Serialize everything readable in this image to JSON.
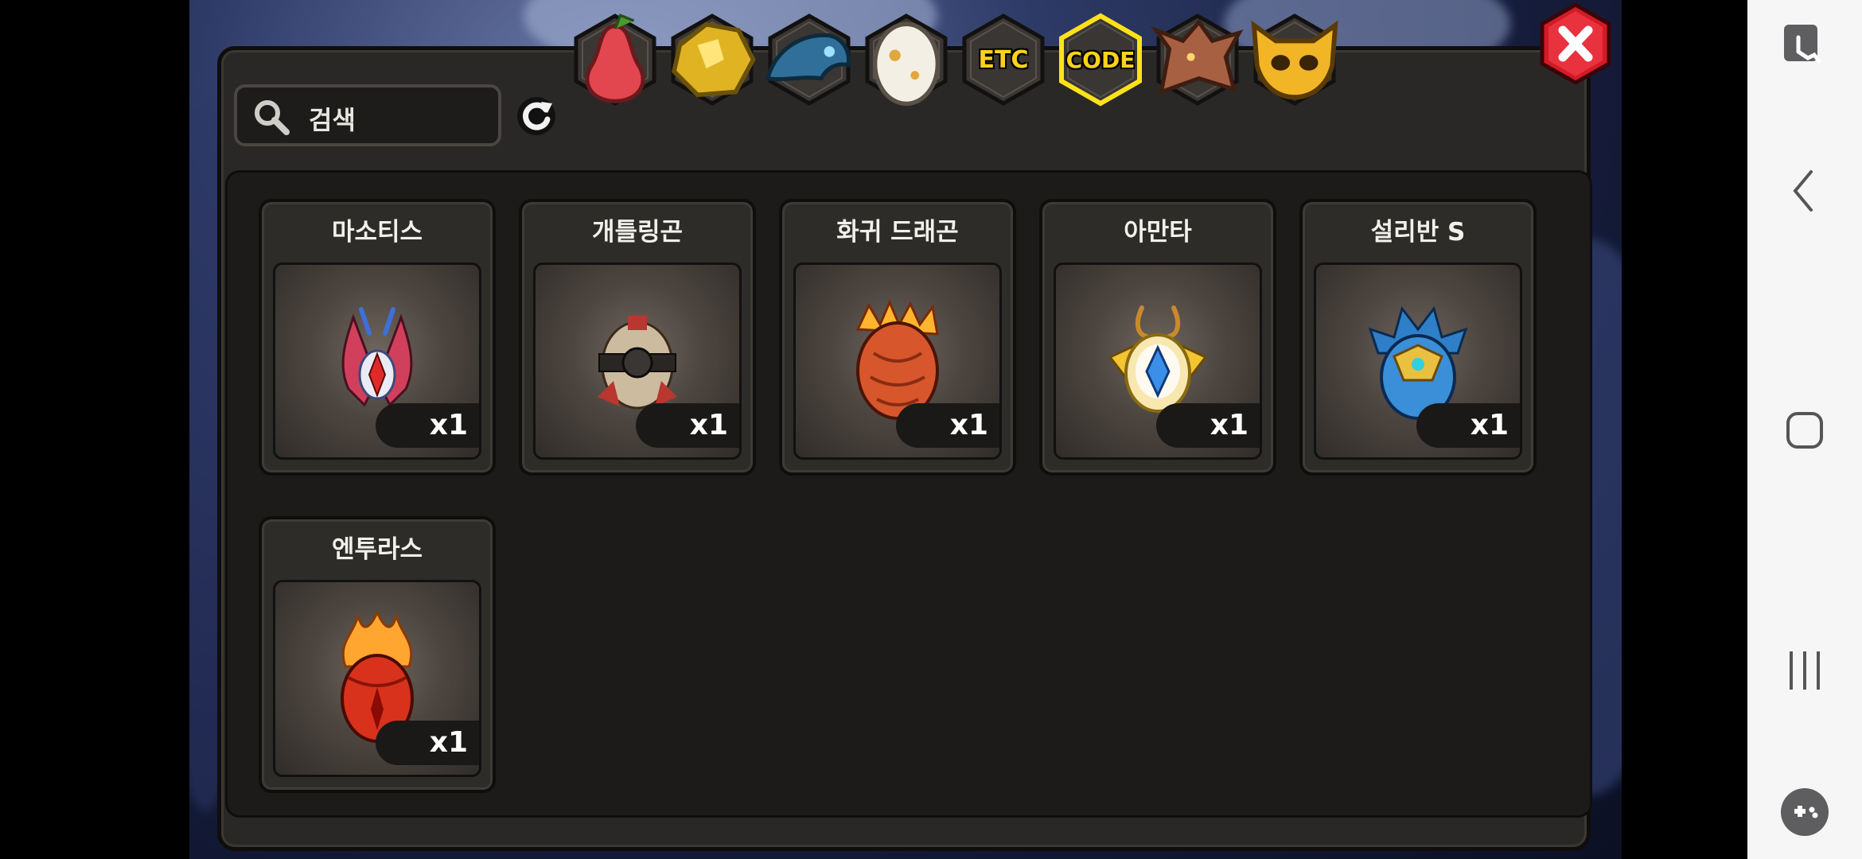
{
  "search": {
    "placeholder": "검색"
  },
  "tabs": [
    {
      "name": "fruit",
      "icon": "pear-icon",
      "active": false
    },
    {
      "name": "gold",
      "icon": "gold-ore-icon",
      "active": false
    },
    {
      "name": "dragon-head",
      "icon": "blue-dragon-icon",
      "active": false
    },
    {
      "name": "egg",
      "icon": "egg-icon",
      "active": false
    },
    {
      "name": "etc",
      "label": "ETC",
      "active": false
    },
    {
      "name": "code",
      "label": "CODE",
      "active": true
    },
    {
      "name": "dragon",
      "icon": "brown-dragon-icon",
      "active": false
    },
    {
      "name": "mask",
      "icon": "golden-mask-icon",
      "active": false
    }
  ],
  "items": [
    {
      "name": "마소티스",
      "qty": "x1",
      "icon": "masotis-egg-icon",
      "color": "#d0405c"
    },
    {
      "name": "개틀링곤",
      "qty": "x1",
      "icon": "gatlinggon-egg-icon",
      "color": "#b8372e"
    },
    {
      "name": "화귀 드래곤",
      "qty": "x1",
      "icon": "fire-dragon-egg-icon",
      "color": "#e0522a"
    },
    {
      "name": "아만타",
      "qty": "x1",
      "icon": "amanta-egg-icon",
      "color": "#e8b330"
    },
    {
      "name": "설리반 S",
      "qty": "x1",
      "icon": "sullivan-s-egg-icon",
      "color": "#2f7fc8"
    },
    {
      "name": "엔투라스",
      "qty": "x1",
      "icon": "enturas-egg-icon",
      "color": "#d8321c"
    }
  ],
  "colors": {
    "accent": "#ffd21a",
    "close": "#d31a27"
  }
}
